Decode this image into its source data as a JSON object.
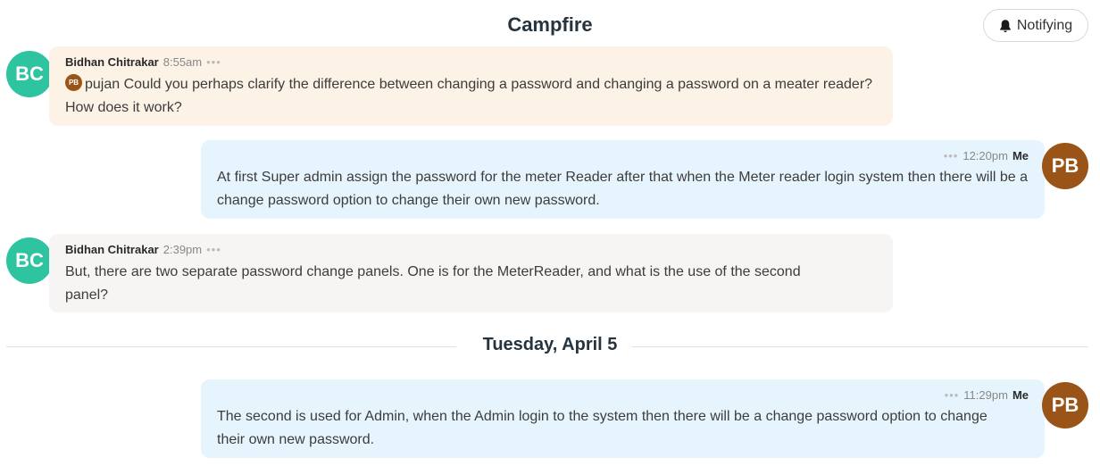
{
  "header": {
    "title": "Campfire",
    "notify_label": "Notifying"
  },
  "messages": [
    {
      "author": "Bidhan Chitrakar",
      "time": "8:55am",
      "avatar": "BC",
      "mention_initials": "PB",
      "text": "pujan Could you perhaps clarify the difference between changing a password and changing a password on a meater reader? How does it work?"
    },
    {
      "author": "Me",
      "time": "12:20pm",
      "avatar": "PB",
      "text": "At first Super admin assign the password for the meter Reader after that when the Meter reader login system then there will be a change password option to change their own new password."
    },
    {
      "author": "Bidhan Chitrakar",
      "time": "2:39pm",
      "avatar": "BC",
      "text": "But, there are two separate password change panels. One is for the MeterReader, and what is the use of the second panel?"
    },
    {
      "author": "Me",
      "time": "11:29pm",
      "avatar": "PB",
      "text": "The second is used for Admin, when the Admin login to the system then there will be a change password option to change their own new password."
    }
  ],
  "date_divider": "Tuesday, April 5",
  "menu_glyph": "•••",
  "colors": {
    "bc_avatar": "#2ec4a0",
    "pb_avatar": "#9a5417",
    "peach_bubble": "#fdf2e6",
    "grey_bubble": "#f6f5f4",
    "blue_bubble": "#e6f5fd"
  }
}
